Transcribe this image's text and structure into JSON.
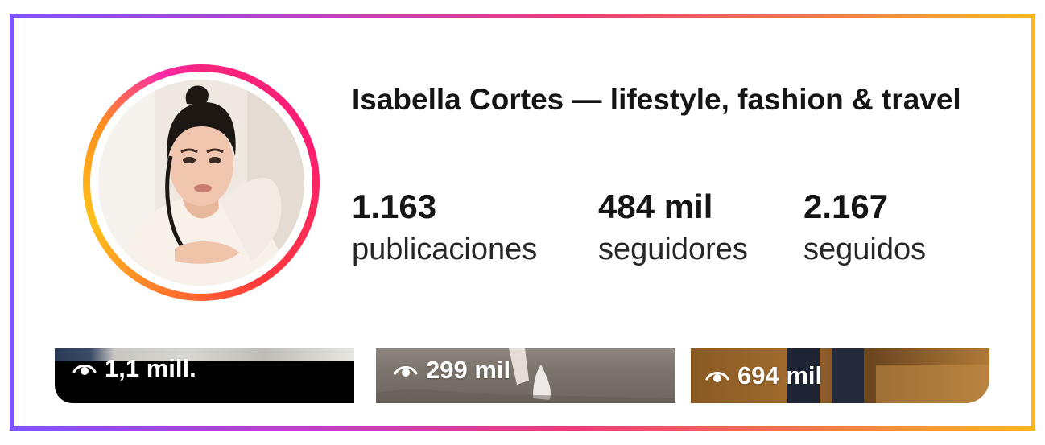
{
  "profile": {
    "name": "Isabella Cortes — lifestyle, fashion & travel",
    "stats": [
      {
        "value": "1.163",
        "label": "publicaciones"
      },
      {
        "value": "484 mil",
        "label": "seguidores"
      },
      {
        "value": "2.167",
        "label": "seguidos"
      }
    ]
  },
  "reels": [
    {
      "views": "1,1 mill.",
      "icon": "eye-icon"
    },
    {
      "views": "299 mil",
      "icon": "eye-icon"
    },
    {
      "views": "694 mil",
      "icon": "eye-icon"
    }
  ],
  "colors": {
    "frame_gradient": [
      "#7f52ff",
      "#c23ec6",
      "#ee3c7a",
      "#f2784b",
      "#f7b81f"
    ],
    "story_ring": [
      "#f5257e",
      "#ff3b3b",
      "#ff7a2b",
      "#ffc21a"
    ]
  }
}
